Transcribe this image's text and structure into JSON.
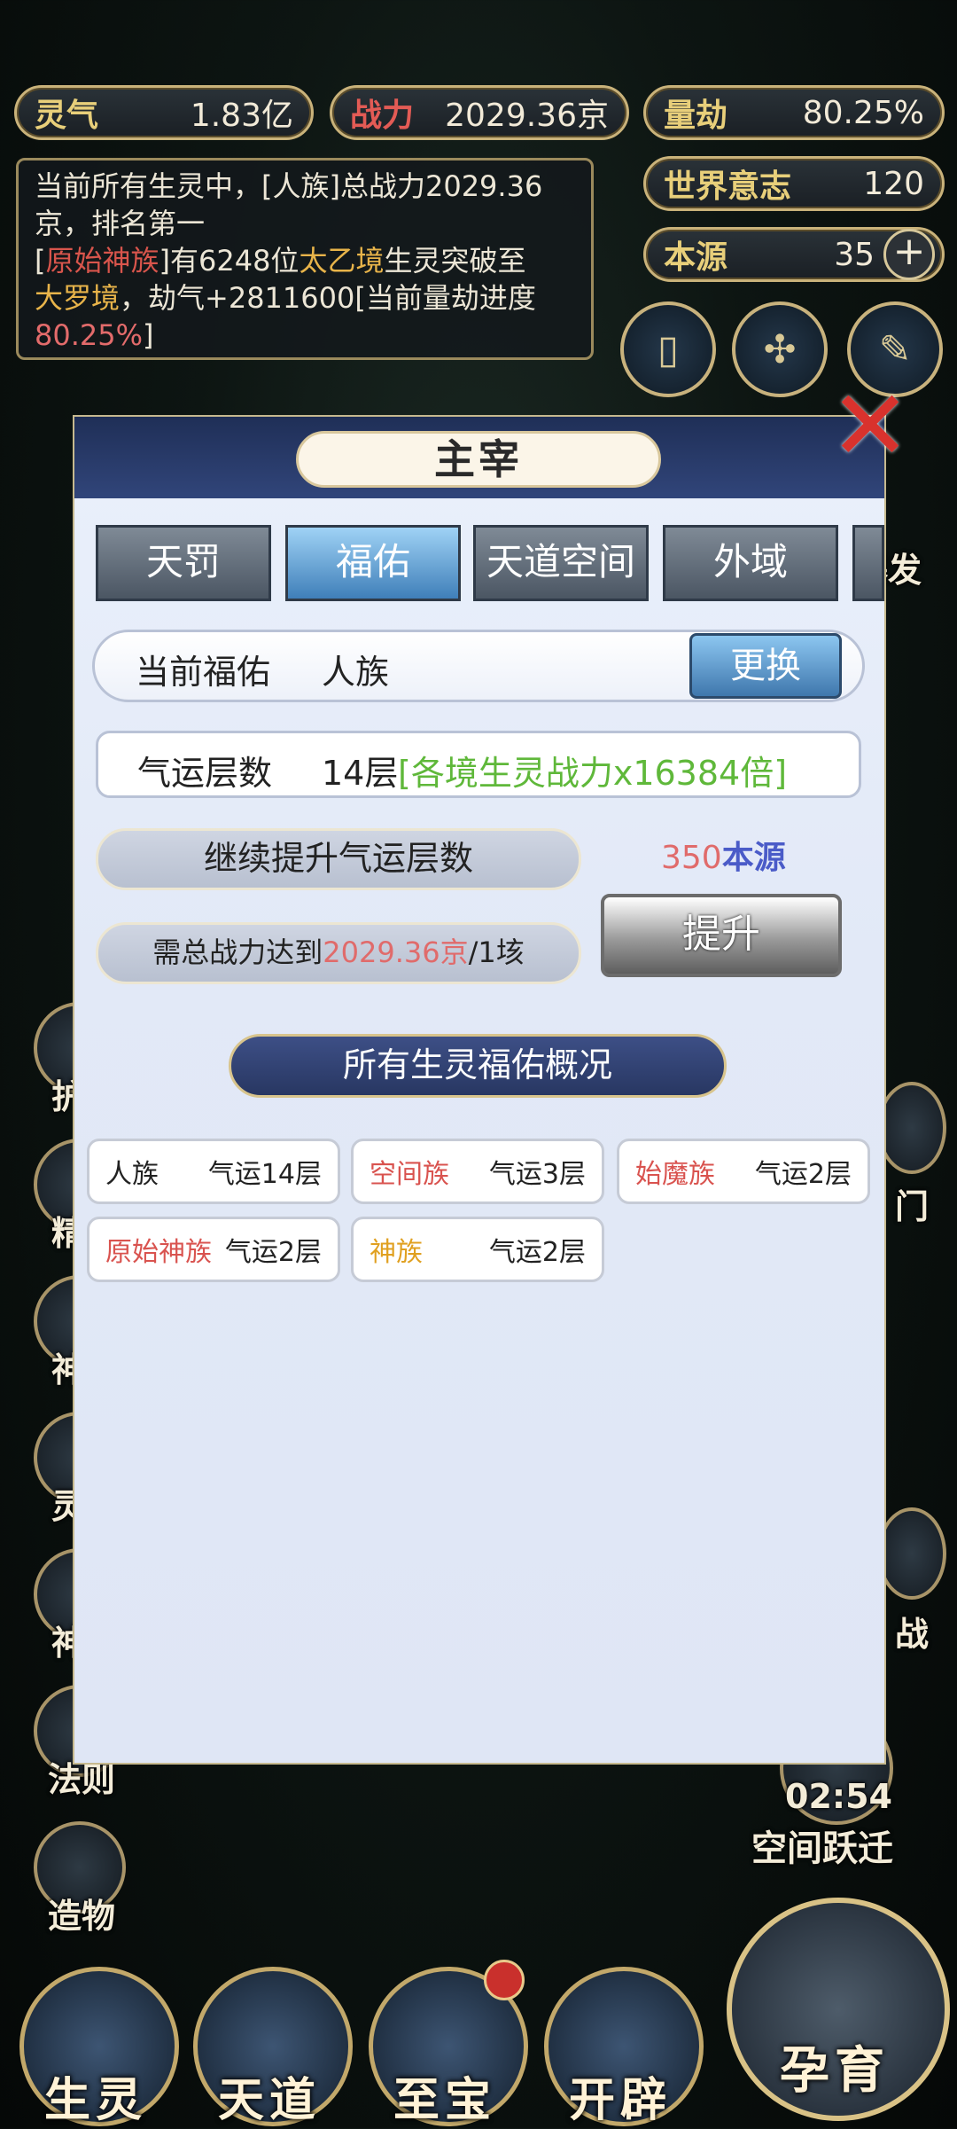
{
  "resources": {
    "lingqi": {
      "label": "灵气",
      "value": "1.83亿"
    },
    "zhanli": {
      "label": "战力",
      "value": "2029.36京"
    },
    "liangjie": {
      "label": "量劫",
      "value": "80.25%"
    },
    "shijie": {
      "label": "世界意志",
      "value": "120"
    },
    "benyuan": {
      "label": "本源",
      "value": "35"
    }
  },
  "notice": {
    "line1": "当前所有生灵中，[人族]总战力2029.36",
    "line2": "京，排名第一",
    "l3_pre": "[",
    "l3_race": "原始神族",
    "l3_mid": "]有6248位",
    "l3_realm": "太乙境",
    "l3_post": "生灵突破至",
    "l4_realm": "大罗境",
    "l4_post": "，劫气+2811600[当前量劫进度",
    "l5_pct": "80.25%",
    "l5_end": "]"
  },
  "side_left": [
    "护",
    "精",
    "神",
    "灵",
    "神",
    "法则",
    "造物"
  ],
  "side_right": [
    "爆发",
    "门",
    "战",
    "空间跃迁"
  ],
  "timer": "02:54",
  "bottom_nav": [
    "生灵",
    "天道",
    "至宝",
    "开辟"
  ],
  "bottom_main": "孕育",
  "dialog": {
    "title": "主宰",
    "tabs": [
      "天罚",
      "福佑",
      "天道空间",
      "外域"
    ],
    "current_label": "当前福佑",
    "current_value": "人族",
    "change_button": "更换",
    "luck_label": "气运层数",
    "luck_value": "14层",
    "luck_bonus": "[各境生灵战力x16384倍]",
    "continue_label": "继续提升气运层数",
    "cost_amount": "350",
    "cost_unit": "本源",
    "require_pre": "需总战力达到",
    "require_value": "2029.36京",
    "require_post": "/1垓",
    "upgrade_button": "提升",
    "overview_title": "所有生灵福佑概况",
    "races": [
      {
        "name": "人族",
        "luck": "气运14层",
        "color": "#222222"
      },
      {
        "name": "空间族",
        "luck": "气运3层",
        "color": "#d9534f"
      },
      {
        "name": "始魔族",
        "luck": "气运2层",
        "color": "#d9534f"
      },
      {
        "name": "原始神族",
        "luck": "气运2层",
        "color": "#d9534f"
      },
      {
        "name": "神族",
        "luck": "气运2层",
        "color": "#e0a020"
      }
    ]
  }
}
